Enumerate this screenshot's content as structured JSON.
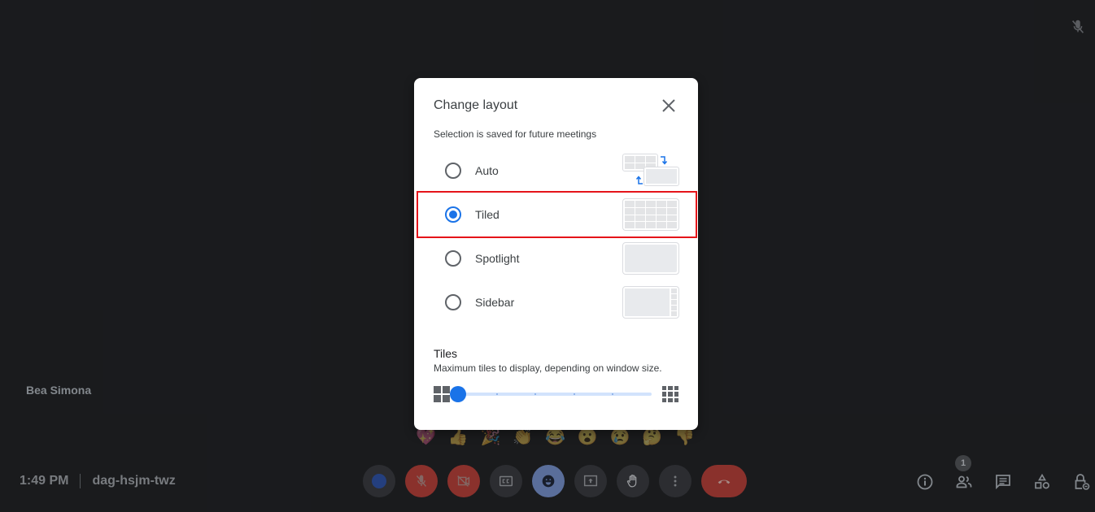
{
  "meeting": {
    "participant_name": "Bea Simona",
    "time": "1:49 PM",
    "meeting_code": "dag-hsjm-twz",
    "participant_count": "1"
  },
  "reactions": [
    "💖",
    "👍",
    "🎉",
    "👏",
    "😂",
    "😮",
    "😢",
    "🤔",
    "👎"
  ],
  "controls": {
    "left_status": "camera-status",
    "mic": "microphone-muted-icon",
    "camera": "camera-off-icon",
    "captions": "closed-captions-icon",
    "emoji": "emoji-reactions-icon",
    "present": "present-screen-icon",
    "raise_hand": "raise-hand-icon",
    "more": "more-options-icon",
    "end_call": "end-call-icon"
  },
  "right_controls": [
    "info-icon",
    "people-icon",
    "chat-icon",
    "activities-icon",
    "host-controls-icon"
  ],
  "dialog": {
    "title": "Change layout",
    "subtitle": "Selection is saved for future meetings",
    "options": [
      {
        "label": "Auto",
        "selected": false
      },
      {
        "label": "Tiled",
        "selected": true
      },
      {
        "label": "Spotlight",
        "selected": false
      },
      {
        "label": "Sidebar",
        "selected": false
      }
    ],
    "tiles_heading": "Tiles",
    "tiles_description": "Maximum tiles to display, depending on window size.",
    "tiles_slider": {
      "steps": 6,
      "value_index": 0
    },
    "colors": {
      "accent": "#1a73e8",
      "highlight_border": "#e5141a"
    }
  }
}
